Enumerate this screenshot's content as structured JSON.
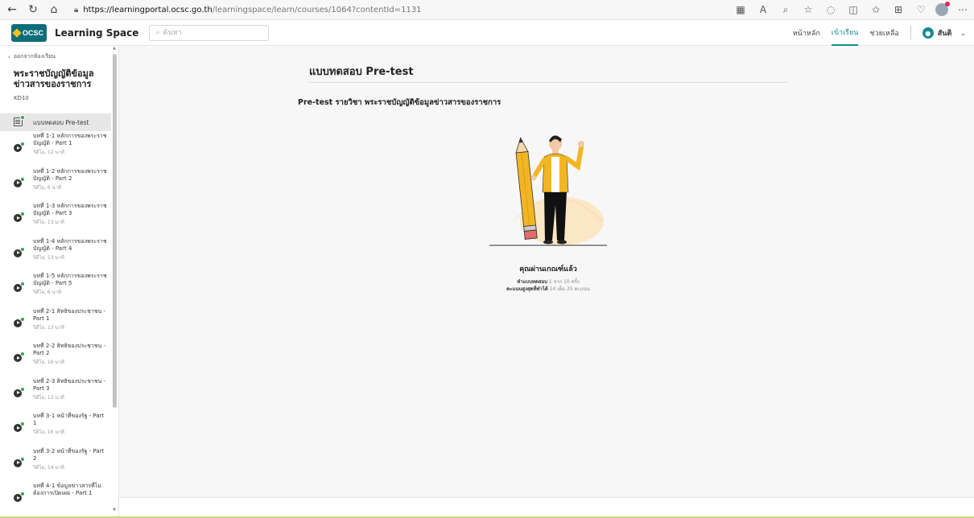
{
  "browser": {
    "url_host": "https://learningportal.ocsc.go.th",
    "url_path": "/learningspace/learn/courses/1064?contentId=1131"
  },
  "header": {
    "logo_text": "OCSC",
    "brand": "Learning Space",
    "search_placeholder": "ค้นหา",
    "nav": [
      "หน้าหลัก",
      "เข้าเรียน",
      "ช่วยเหลือ"
    ],
    "active_nav": "เข้าเรียน",
    "user_name": "สันติ"
  },
  "sidebar": {
    "back_label": "ออกจากห้องเรียน",
    "course_title": "พระราชบัญญัติข้อมูลข่าวสารของราชการ",
    "course_code": "KD10",
    "lessons": [
      {
        "name": "แบบทดสอบ Pre-test",
        "meta": ""
      },
      {
        "name": "บทที่ 1-1 หลักการของพระราชบัญญัติ - Part 1",
        "meta": "วิดีโอ, 12 นาที"
      },
      {
        "name": "บทที่ 1-2 หลักการของพระราชบัญญัติ - Part 2",
        "meta": "วิดีโอ, 6 นาที"
      },
      {
        "name": "บทที่ 1-3 หลักการของพระราชบัญญัติ - Part 3",
        "meta": "วิดีโอ, 13 นาที"
      },
      {
        "name": "บทที่ 1-4 หลักการของพระราชบัญญัติ - Part 4",
        "meta": "วิดีโอ, 13 นาที"
      },
      {
        "name": "บทที่ 1-5 หลักการของพระราชบัญญัติ - Part 5",
        "meta": "วิดีโอ, 6 นาที"
      },
      {
        "name": "บทที่ 2-1 สิทธิของประชาชน - Part 1",
        "meta": "วิดีโอ, 13 นาที"
      },
      {
        "name": "บทที่ 2-2 สิทธิของประชาชน - Part 2",
        "meta": "วิดีโอ, 16 นาที"
      },
      {
        "name": "บทที่ 2-3 สิทธิของประชาชน - Part 3",
        "meta": "วิดีโอ, 13 นาที"
      },
      {
        "name": "บทที่ 3-1 หน้าที่ของรัฐ - Part 1",
        "meta": "วิดีโอ, 16 นาที"
      },
      {
        "name": "บทที่ 3-2 หน้าที่ของรัฐ - Part 2",
        "meta": "วิดีโอ, 14 นาที"
      },
      {
        "name": "บทที่ 4-1 ข้อมูลข่าวสารที่ไม่ต้องการเปิดเผย - Part 1",
        "meta": ""
      }
    ]
  },
  "main": {
    "title": "แบบทดสอบ Pre-test",
    "subtitle": "Pre-test รายวิชา พระราชบัญญัติข้อมูลข่าวสารของราชการ",
    "result_title": "คุณผ่านเกณฑ์แล้ว",
    "attempts_label": "ทำแบบทดสอบ",
    "attempts_value": "1 จาก 10 ครั้ง",
    "score_label": "คะแนนสูงสุดที่ทำได้",
    "score_value": "14 เต็ม 25 คะแนน"
  },
  "colors": {
    "accent": "#1a8a96",
    "check": "#2fa84f",
    "pencil": "#f2b523",
    "jacket": "#f2b523"
  }
}
